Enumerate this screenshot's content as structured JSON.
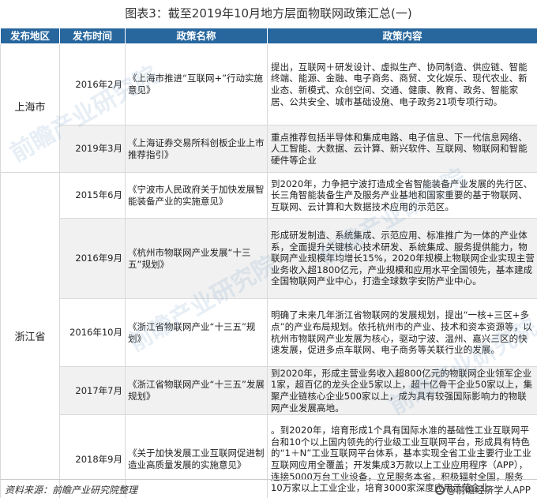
{
  "title": "图表3：截至2019年10月地方层面物联网政策汇总(一)",
  "headers": [
    "发布地区",
    "发布时间",
    "政策名称",
    "政策内容"
  ],
  "regions": [
    "上海市",
    "浙江省"
  ],
  "rows": [
    {
      "date": "2016年2月",
      "name": "《上海市推进“互联网+”行动实施意见》",
      "content": "提出，互联网＋研发设计、虚拟生产、协同制造、供应链、智能终端、能源、金融、电子商务、商贸、文化娱乐、现代农业、新业态、新模式、众创空间、交通、健康、教育、政务、智能家居、公共安全、城市基础设施、电子政务21项专项行动。"
    },
    {
      "date": "2019年3月",
      "name": "《上海证券交易所科创板企业上市推荐指引》",
      "content": "重点推荐包括半导体和集成电路、电子信息、下一代信息网络、人工智能、大数据、云计算、新兴软件、互联网、物联网和智能硬件等企业"
    },
    {
      "date": "2015年6月",
      "name": "《宁波市人民政府关于加快发展智能装备产业的实施意见》",
      "content": "到2020年，力争把宁波打造成全省智能装备产业发展的先行区、长三角智能装备生产及服务产业基地和国家重要的基于物联网、互联网、云计算和大数据技术应用的示范区。"
    },
    {
      "date": "2016年9月",
      "name": "《杭州市物联网产业发展“十三五”规划》",
      "content": "形成研发制造、系统集成、示范应用、标准推广为一体的产业体系，全面提升关键核心技术研发、系统集成、服务提供能力，物联网产业规模年均增长15%，2020年规模上物联网企业实现主营业务收入超1800亿元，产业规模和应用水平全国领先，基本建成全国物联网产业中心，打造全球数字安防产业中心。"
    },
    {
      "date": "2016年10月",
      "name": "《浙江省物联网产业“十三五”规划》",
      "content": "明确了未来几年浙江省物联网的发展规划，提出“一核+三区+多点”的产业布局规划。依托杭州市的产业、技术和资本资源等，以杭州市物联网产业发展为核心，驱动宁波、温州、嘉兴三区的快速发展，促进多点车联网、电子商务等关联行业的发展。"
    },
    {
      "date": "2017年7月",
      "name": "《浙江省物联网产业“十三五”发展规划》",
      "content": "到2020年，形成主营业务收入超800亿元的物联网企业领军企业1家，超百亿的龙头企业5家以上，超十亿骨干企业50家以上，集聚产业链核心企业500家以上，成为具有较强国际影响力的物联网产业发展高地。"
    },
    {
      "date": "2018年9月",
      "name": "《关于加快发展工业互联网促进制造业高质量发展的实施意见》",
      "content": "。到2020年，培育形成1个具有国际水准的基础性工业互联网平台和10个以上国内领先的行业级工业互联网平台，形成具有特色的“1＋N”工业互联网平台体系，基本实现全省工业主要行业工业互联网应用全覆盖；开发集成3万款以上工业应用程序（APP），连接5000万台工业设备，立足服务本省，积极辐射全国，服务10万家以上工业企业，培育3000家深度应用示范企业。"
    }
  ],
  "watermark": "前瞻产业研究院",
  "footer": {
    "source": "资料来源：前瞻产业研究院整理",
    "brand": "@前瞻经济学人APP"
  }
}
